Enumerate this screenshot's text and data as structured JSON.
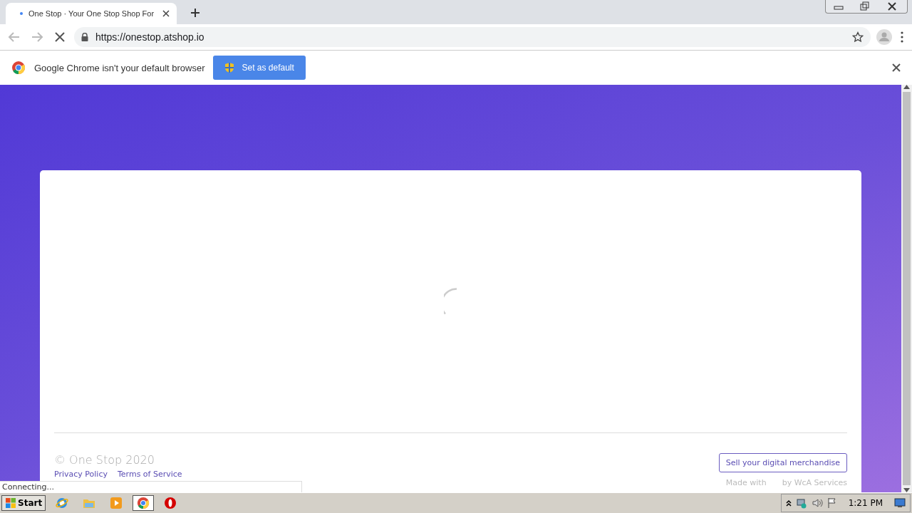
{
  "browser": {
    "tabs": [
      {
        "title": "One Stop · Your One Stop Shop For",
        "selected": true
      }
    ],
    "url": "https://onestop.atshop.io",
    "loading": true
  },
  "infobar": {
    "message": "Google Chrome isn't your default browser",
    "button": "Set as default"
  },
  "page": {
    "copyright": "© One Stop 2020",
    "links": [
      "Privacy Policy",
      "Terms of Service"
    ],
    "sell_button": "Sell your digital merchandise",
    "made_with": "Made with",
    "by": "by WcA Services",
    "loading": true
  },
  "status_bubble": "Connecting...",
  "taskbar": {
    "start": "Start",
    "apps": [
      {
        "kind": "ie",
        "selected": false
      },
      {
        "kind": "folder",
        "selected": false
      },
      {
        "kind": "media",
        "selected": false
      },
      {
        "kind": "chrome",
        "selected": true
      },
      {
        "kind": "opera",
        "selected": false
      }
    ],
    "clock": "1:21 PM"
  }
}
